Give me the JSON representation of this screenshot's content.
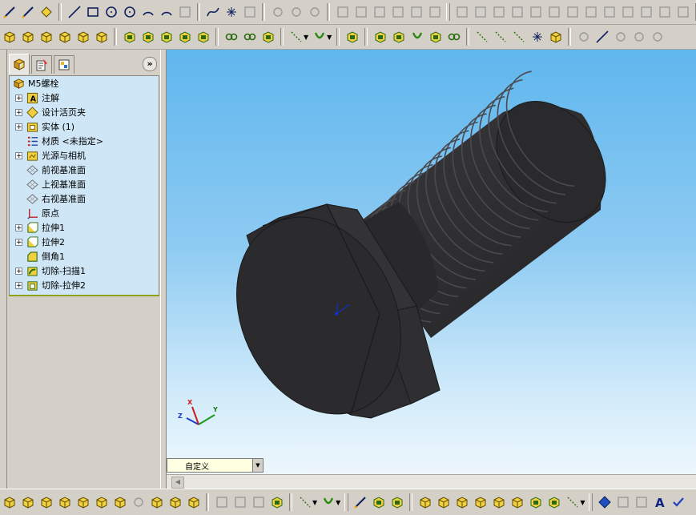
{
  "feature_tree": {
    "root": "M5螺栓",
    "items": [
      {
        "label": "注解",
        "expandable": true,
        "icon": "annotation-icon"
      },
      {
        "label": "设计活页夹",
        "expandable": true,
        "icon": "design-binder-icon"
      },
      {
        "label": "实体 (1)",
        "expandable": true,
        "icon": "solid-bodies-icon"
      },
      {
        "label": "材质 <未指定>",
        "expandable": false,
        "icon": "material-icon"
      },
      {
        "label": "光源与相机",
        "expandable": true,
        "icon": "lights-cameras-icon"
      },
      {
        "label": "前视基准面",
        "expandable": false,
        "icon": "plane-icon"
      },
      {
        "label": "上视基准面",
        "expandable": false,
        "icon": "plane-icon"
      },
      {
        "label": "右视基准面",
        "expandable": false,
        "icon": "plane-icon"
      },
      {
        "label": "原点",
        "expandable": false,
        "icon": "origin-icon"
      },
      {
        "label": "拉伸1",
        "expandable": true,
        "icon": "extrude-icon"
      },
      {
        "label": "拉伸2",
        "expandable": true,
        "icon": "extrude-icon"
      },
      {
        "label": "倒角1",
        "expandable": false,
        "icon": "chamfer-icon"
      },
      {
        "label": "切除-扫描1",
        "expandable": true,
        "icon": "cut-sweep-icon"
      },
      {
        "label": "切除-拉伸2",
        "expandable": true,
        "icon": "cut-extrude-icon"
      }
    ]
  },
  "configuration": {
    "current": "自定义"
  },
  "triad": {
    "x": "X",
    "y": "Y",
    "z": "Z"
  },
  "colors": {
    "tree_bg": "#cfe6f6",
    "viewport_top": "#5fb6ee",
    "viewport_bottom": "#f2f9fd",
    "model": "#2c2c2e"
  }
}
